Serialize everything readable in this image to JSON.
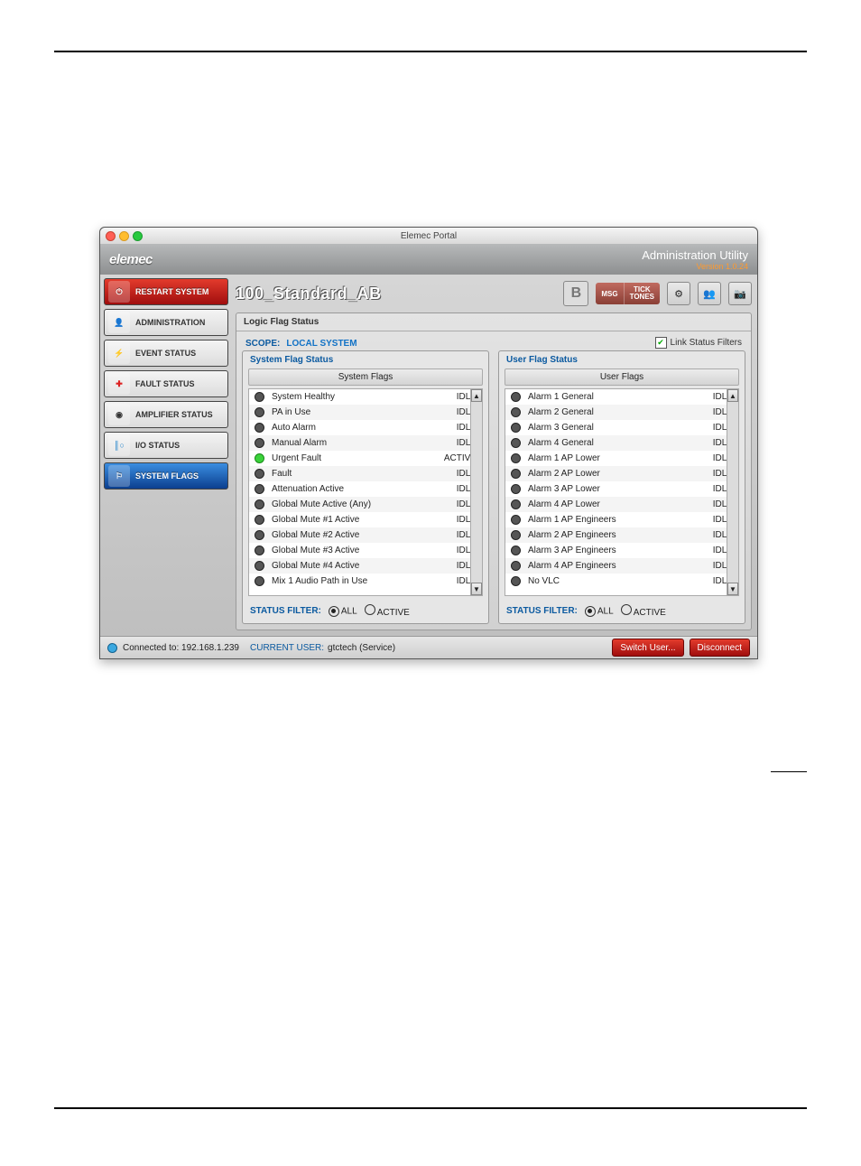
{
  "window": {
    "title": "Elemec Portal"
  },
  "brand": {
    "logo": "elemec",
    "title": "Administration Utility",
    "version": "Version 1.0.24"
  },
  "sidebar": [
    "RESTART SYSTEM",
    "ADMINISTRATION",
    "EVENT STATUS",
    "FAULT STATUS",
    "AMPLIFIER STATUS",
    "I/O STATUS",
    "SYSTEM FLAGS"
  ],
  "header": {
    "config": "100_Standard_AB",
    "badge": "B",
    "pill": [
      "MSG",
      "TICK",
      "TONES"
    ]
  },
  "panel": {
    "title": "Logic Flag Status",
    "scope_label": "SCOPE:",
    "scope_value": "LOCAL SYSTEM",
    "link_filters": "Link Status Filters"
  },
  "system": {
    "heading": "System Flag Status",
    "title": "System Flags",
    "rows": [
      {
        "n": "System Healthy",
        "s": "IDLE"
      },
      {
        "n": "PA in Use",
        "s": "IDLE"
      },
      {
        "n": "Auto Alarm",
        "s": "IDLE"
      },
      {
        "n": "Manual Alarm",
        "s": "IDLE"
      },
      {
        "n": "Urgent Fault",
        "s": "ACTIVE"
      },
      {
        "n": "Fault",
        "s": "IDLE"
      },
      {
        "n": "Attenuation Active",
        "s": "IDLE"
      },
      {
        "n": "Global Mute Active (Any)",
        "s": "IDLE"
      },
      {
        "n": "Global Mute #1 Active",
        "s": "IDLE"
      },
      {
        "n": "Global Mute #2 Active",
        "s": "IDLE"
      },
      {
        "n": "Global Mute #3 Active",
        "s": "IDLE"
      },
      {
        "n": "Global Mute #4 Active",
        "s": "IDLE"
      },
      {
        "n": "Mix 1 Audio Path in Use",
        "s": "IDLE"
      }
    ]
  },
  "user": {
    "heading": "User Flag Status",
    "title": "User Flags",
    "rows": [
      {
        "n": "Alarm 1 General",
        "s": "IDLE"
      },
      {
        "n": "Alarm 2 General",
        "s": "IDLE"
      },
      {
        "n": "Alarm 3 General",
        "s": "IDLE"
      },
      {
        "n": "Alarm 4 General",
        "s": "IDLE"
      },
      {
        "n": "Alarm 1 AP Lower",
        "s": "IDLE"
      },
      {
        "n": "Alarm 2 AP Lower",
        "s": "IDLE"
      },
      {
        "n": "Alarm 3 AP Lower",
        "s": "IDLE"
      },
      {
        "n": "Alarm 4 AP Lower",
        "s": "IDLE"
      },
      {
        "n": "Alarm 1 AP Engineers",
        "s": "IDLE"
      },
      {
        "n": "Alarm 2 AP Engineers",
        "s": "IDLE"
      },
      {
        "n": "Alarm 3 AP Engineers",
        "s": "IDLE"
      },
      {
        "n": "Alarm 4 AP  Engineers",
        "s": "IDLE"
      },
      {
        "n": "No VLC",
        "s": "IDLE"
      }
    ]
  },
  "filter": {
    "label": "STATUS FILTER:",
    "all": "ALL",
    "active": "ACTIVE"
  },
  "footer": {
    "connected": "Connected to: 192.168.1.239",
    "user_label": "CURRENT USER:",
    "user_value": "gtctech  (Service)",
    "switch": "Switch User...",
    "disconnect": "Disconnect"
  }
}
